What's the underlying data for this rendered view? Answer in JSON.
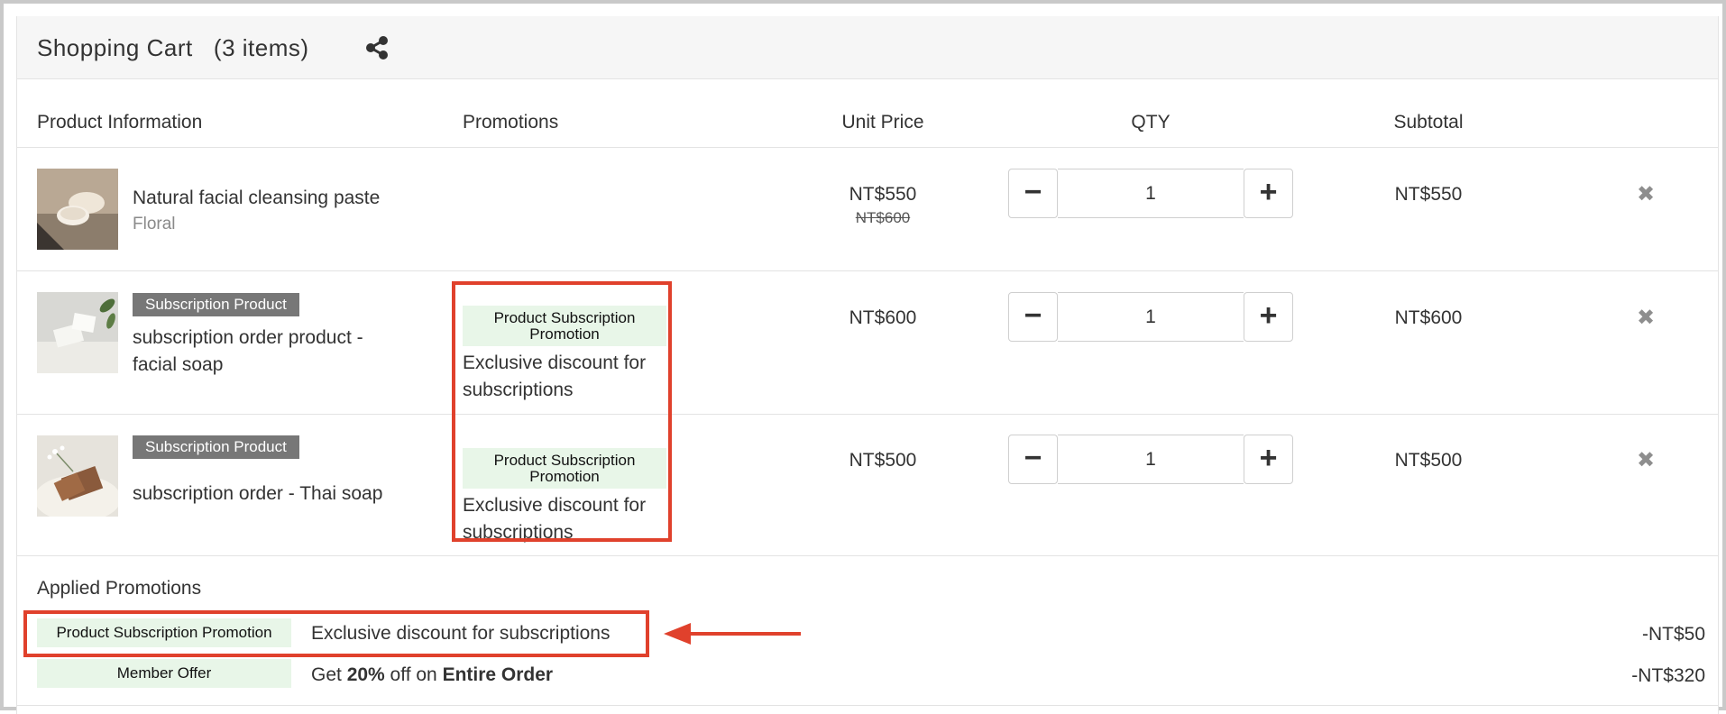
{
  "header": {
    "title": "Shopping Cart",
    "count": "(3 items)",
    "share_icon": "share-icon"
  },
  "columns": {
    "product": "Product Information",
    "promotions": "Promotions",
    "unit_price": "Unit Price",
    "qty": "QTY",
    "subtotal": "Subtotal"
  },
  "items": [
    {
      "name": "Natural facial cleansing paste",
      "variant": "Floral",
      "badge": "",
      "price": "NT$550",
      "old_price": "NT$600",
      "promo_tag": "",
      "promo_desc": "",
      "qty": "1",
      "subtotal": "NT$550"
    },
    {
      "name": "subscription order product - facial soap",
      "variant": "",
      "badge": "Subscription Product",
      "price": "NT$600",
      "old_price": "",
      "promo_tag": "Product Subscription Promotion",
      "promo_desc": "Exclusive discount for subscriptions",
      "qty": "1",
      "subtotal": "NT$600"
    },
    {
      "name": "subscription order - Thai soap",
      "variant": "",
      "badge": "Subscription Product",
      "price": "NT$500",
      "old_price": "",
      "promo_tag": "Product Subscription Promotion",
      "promo_desc": "Exclusive discount for subscriptions",
      "qty": "1",
      "subtotal": "NT$500"
    }
  ],
  "controls": {
    "minus": "−",
    "plus": "+",
    "remove": "✖"
  },
  "applied": {
    "title": "Applied Promotions",
    "promotions": [
      {
        "tag": "Product Subscription Promotion",
        "desc": "Exclusive discount for subscriptions",
        "amount": "-NT$50"
      },
      {
        "tag": "Member Offer",
        "desc_prefix": "Get ",
        "desc_bold1": "20%",
        "desc_mid": " off on ",
        "desc_bold2": "Entire Order",
        "amount": "-NT$320"
      }
    ]
  },
  "colors": {
    "highlight_red": "#e0412c",
    "promo_green_bg": "#e8f6e8",
    "badge_gray": "#777777"
  }
}
